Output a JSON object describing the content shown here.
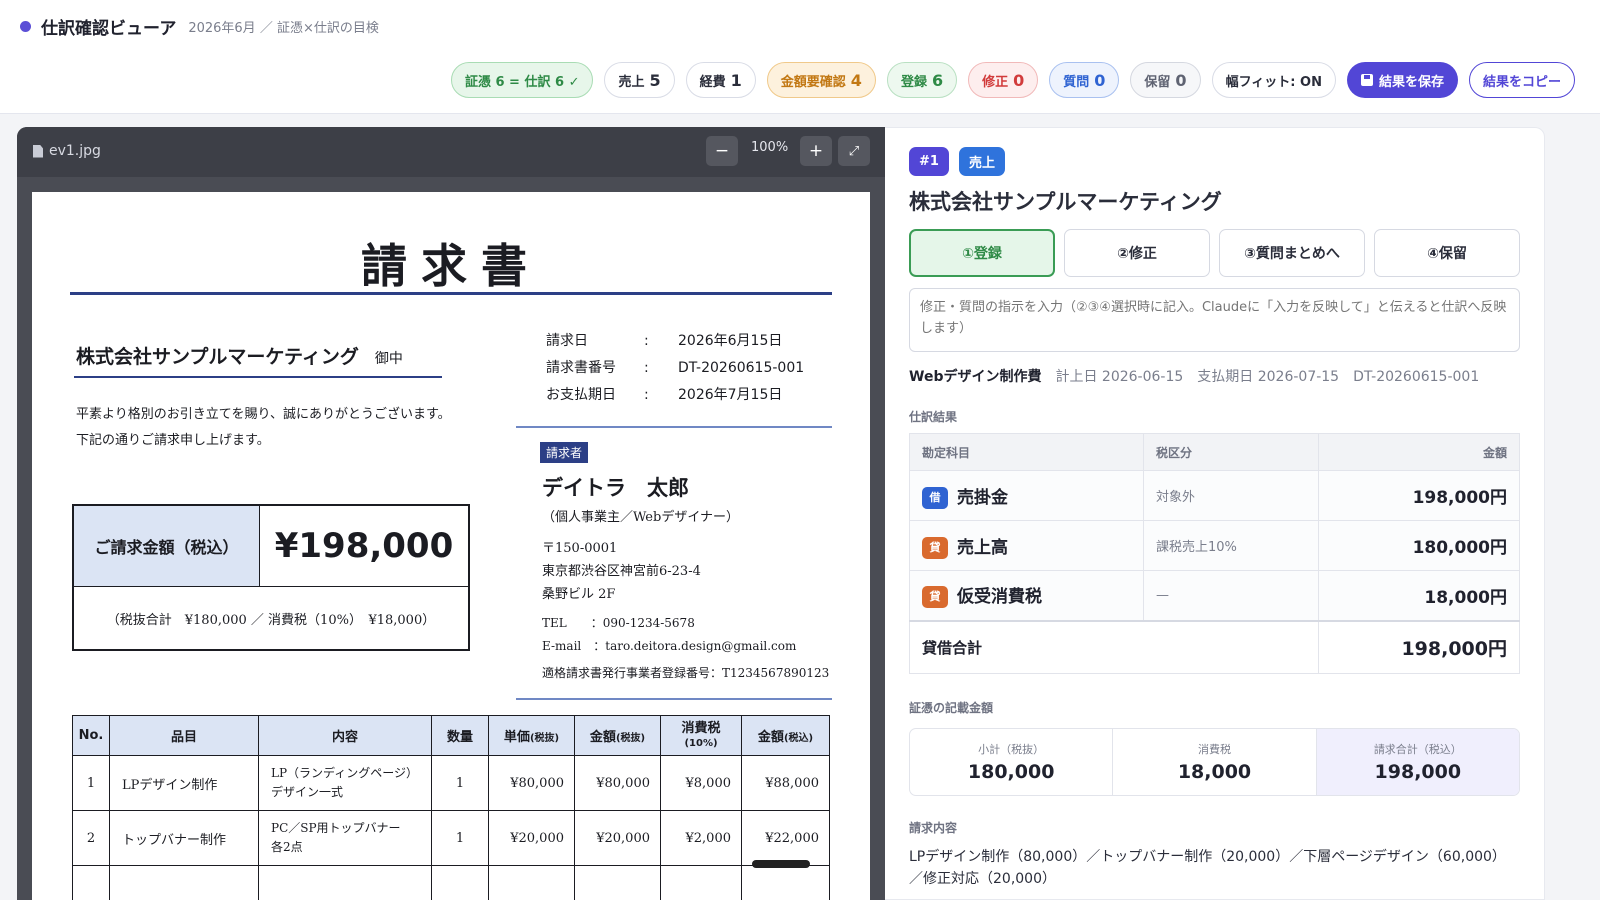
{
  "header": {
    "app_title": "仕訳確認ビューア",
    "subtitle": "2026年6月 ／ 証憑×仕訳の目検",
    "chips": {
      "match_label": "証憑 6 = 仕訳 6 ✓",
      "sales_label": "売上",
      "sales_count": "5",
      "expense_label": "経費",
      "expense_count": "1",
      "amount_label": "金額要確認",
      "amount_count": "4",
      "register_label": "登録",
      "register_count": "6",
      "fix_label": "修正",
      "fix_count": "0",
      "question_label": "質問",
      "question_count": "0",
      "hold_label": "保留",
      "hold_count": "0",
      "fit_label": "幅フィット: ON"
    },
    "save_label": "結果を保存",
    "copy_label": "結果をコピー"
  },
  "viewer": {
    "filename": "ev1.jpg",
    "zoom_out": "−",
    "zoom": "100%",
    "zoom_in": "+",
    "fullscreen": "⤢"
  },
  "invoice": {
    "title": "請求書",
    "client": "株式会社サンプルマーケティング",
    "honorific": "御中",
    "greeting_1": "平素より格別のお引き立てを賜り、誠にありがとうございます。",
    "greeting_2": "下記の通りご請求申し上げます。",
    "meta": [
      {
        "k": "請求日",
        "v": "2026年6月15日"
      },
      {
        "k": "請求書番号",
        "v": "DT-20260615-001"
      },
      {
        "k": "お支払期日",
        "v": "2026年7月15日"
      }
    ],
    "amount_label": "ご請求金額（税込）",
    "amount": "¥198,000",
    "breakdown": "（税抜合計　¥180,000 ／ 消費税（10%）　¥18,000）",
    "issuer_tag": "請求者",
    "issuer_name": "デイトラ　太郎",
    "issuer_role": "（個人事業主／Webデザイナー）",
    "postal": "〒150-0001",
    "address": "東京都渋谷区神宮前6-23-4",
    "building": "桑野ビル 2F",
    "tel": "TEL　　：090-1234-5678",
    "email": "E-mail　：taro.deitora.design@gmail.com",
    "registration": "適格請求書発行事業者登録番号：T1234567890123",
    "headers": {
      "no": "No.",
      "item": "品目",
      "desc": "内容",
      "qty": "数量",
      "unit": "単価",
      "unit_sub": "(税抜)",
      "amount": "金額",
      "amount_sub": "(税抜)",
      "tax": "消費税",
      "tax_sub": "(10%)",
      "total": "金額",
      "total_sub": "(税込)"
    },
    "rows": [
      {
        "no": "1",
        "item": "LPデザイン制作",
        "desc1": "LP（ランディングページ）",
        "desc2": "デザイン一式",
        "qty": "1",
        "unit": "¥80,000",
        "amount": "¥80,000",
        "tax": "¥8,000",
        "total": "¥88,000"
      },
      {
        "no": "2",
        "item": "トップバナー制作",
        "desc1": "PC／SP用トップバナー",
        "desc2": "各2点",
        "qty": "1",
        "unit": "¥20,000",
        "amount": "¥20,000",
        "tax": "¥2,000",
        "total": "¥22,000"
      }
    ]
  },
  "panel": {
    "badge_num": "#1",
    "badge_type": "売上",
    "title": "株式会社サンプルマーケティング",
    "actions": [
      "①登録",
      "②修正",
      "③質問まとめへ",
      "④保留"
    ],
    "note_placeholder": "修正・質問の指示を入力（②③④選択時に記入。Claudeに「入力を反映して」と伝えると仕訳へ反映します）",
    "summary": {
      "name": "Webデザイン制作費",
      "posting": "計上日 2026-06-15",
      "due": "支払期日 2026-07-15",
      "doc": "DT-20260615-001"
    },
    "journal_section": "仕訳結果",
    "journal_headers": {
      "account": "勘定科目",
      "tax": "税区分",
      "amount": "金額"
    },
    "journal_rows": [
      {
        "side": "借",
        "account": "売掛金",
        "tax": "対象外",
        "amount": "198,000円"
      },
      {
        "side": "貸",
        "account": "売上高",
        "tax": "課税売上10%",
        "amount": "180,000円"
      },
      {
        "side": "貸",
        "account": "仮受消費税",
        "tax": "—",
        "amount": "18,000円"
      }
    ],
    "journal_total_label": "貸借合計",
    "journal_total": "198,000円",
    "evidence_section": "証憑の記載金額",
    "evidence": [
      {
        "k": "小計（税抜）",
        "v": "180,000"
      },
      {
        "k": "消費税",
        "v": "18,000"
      },
      {
        "k": "請求合計（税込）",
        "v": "198,000"
      }
    ],
    "content_section": "請求内容",
    "content": "LPデザイン制作（80,000）／トップバナー制作（20,000）／下層ページデザイン（60,000）／修正対応（20,000）"
  }
}
